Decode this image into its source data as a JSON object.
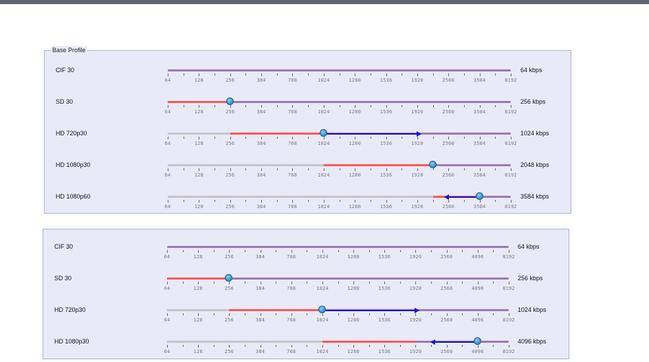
{
  "panels": [
    {
      "legend": "Base Profile",
      "ticks": [
        "64",
        "128",
        "256",
        "384",
        "768",
        "1024",
        "1280",
        "1536",
        "1920",
        "2560",
        "3584",
        "8192"
      ],
      "rows": [
        {
          "label": "CIF 30",
          "rate": "64 kbps",
          "gray_to": 0,
          "red_to": 0,
          "thumb": null,
          "arrow": null
        },
        {
          "label": "SD 30",
          "rate": "256 kbps",
          "gray_to": 0,
          "red_to": 2,
          "thumb": 2,
          "arrow": null
        },
        {
          "label": "HD 720p30",
          "rate": "1024 kbps",
          "gray_to": 2,
          "red_to": 5,
          "thumb": 5,
          "arrow": {
            "dir": "right",
            "to": 8
          }
        },
        {
          "label": "HD 1080p30",
          "rate": "2048 kbps",
          "gray_to": 5,
          "red_to": 8.5,
          "thumb": 8.5,
          "arrow": null
        },
        {
          "label": "HD 1080p60",
          "rate": "3584 kbps",
          "gray_to": 8.5,
          "red_to": 10,
          "thumb": 10,
          "arrow": {
            "dir": "left",
            "to": 9
          }
        }
      ]
    },
    {
      "legend": "",
      "ticks": [
        "64",
        "128",
        "256",
        "384",
        "768",
        "1024",
        "1280",
        "1536",
        "1920",
        "2560",
        "4096",
        "8192"
      ],
      "rows": [
        {
          "label": "CIF 30",
          "rate": "64 kbps",
          "gray_to": 0,
          "red_to": 0,
          "thumb": null,
          "arrow": null
        },
        {
          "label": "SD 30",
          "rate": "256 kbps",
          "gray_to": 0,
          "red_to": 2,
          "thumb": 2,
          "arrow": null
        },
        {
          "label": "HD 720p30",
          "rate": "1024 kbps",
          "gray_to": 2,
          "red_to": 5,
          "thumb": 5,
          "arrow": {
            "dir": "right",
            "to": 8
          }
        },
        {
          "label": "HD 1080p30",
          "rate": "4096 kbps",
          "gray_to": 5,
          "red_to": 8,
          "thumb": 10,
          "arrow": {
            "dir": "left",
            "to": 8.6
          }
        }
      ]
    }
  ]
}
